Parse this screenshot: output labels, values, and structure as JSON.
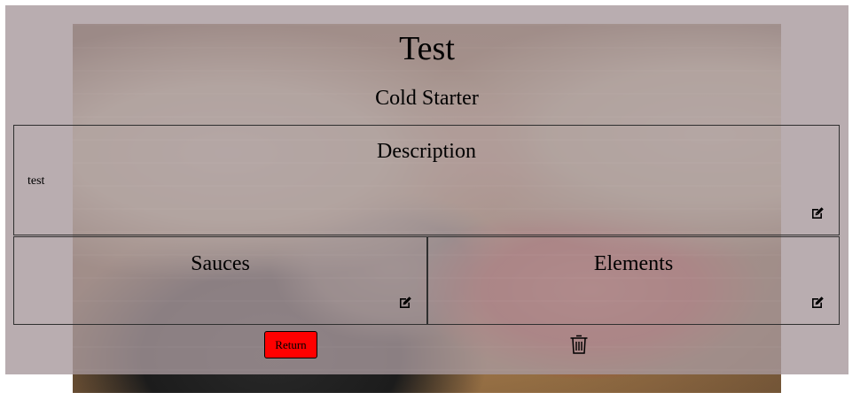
{
  "dish": {
    "name": "Test",
    "category": "Cold Starter"
  },
  "description": {
    "heading": "Description",
    "text": "test",
    "edit_icon": "edit-icon"
  },
  "sauces": {
    "heading": "Sauces",
    "edit_icon": "edit-icon"
  },
  "elements": {
    "heading": "Elements",
    "edit_icon": "edit-icon"
  },
  "actions": {
    "return_label": "Return",
    "delete_icon": "trash-icon"
  },
  "colors": {
    "overlay": "#a7989c",
    "return_button": "#ff0000",
    "panel_border": "#2f2f2f"
  }
}
